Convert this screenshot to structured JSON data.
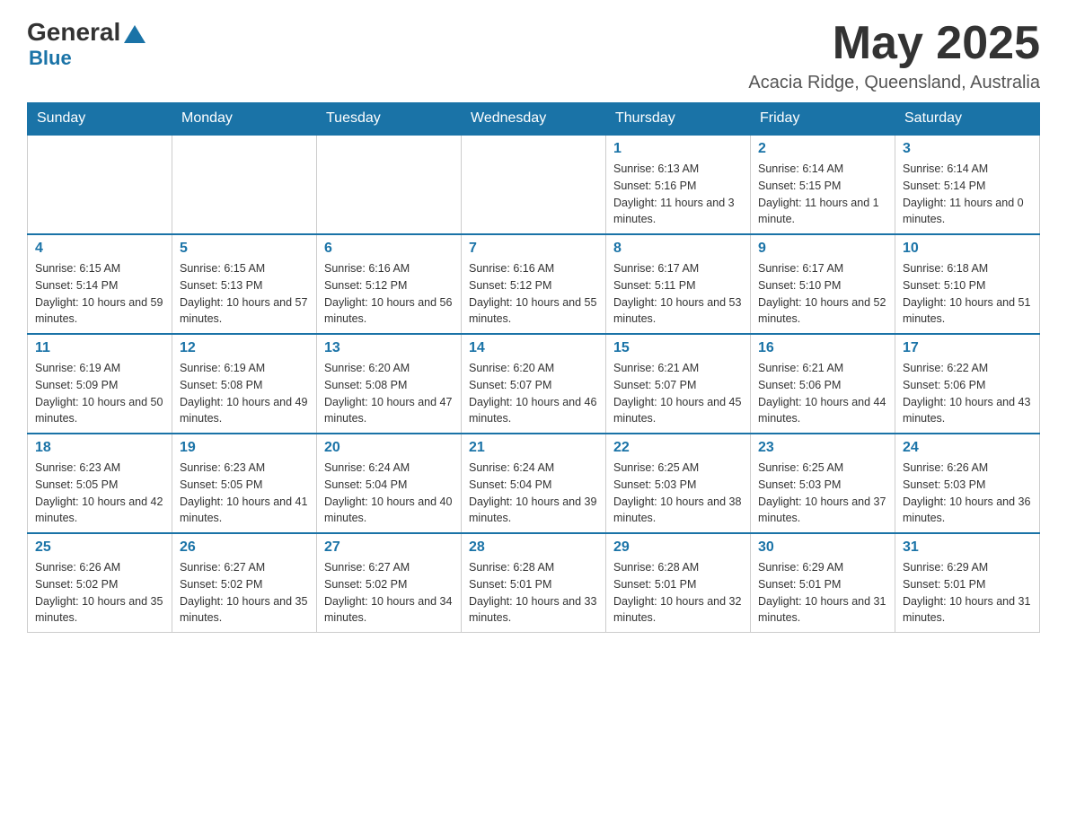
{
  "header": {
    "logo": {
      "general": "General",
      "blue": "Blue"
    },
    "month_title": "May 2025",
    "location": "Acacia Ridge, Queensland, Australia"
  },
  "calendar": {
    "days_of_week": [
      "Sunday",
      "Monday",
      "Tuesday",
      "Wednesday",
      "Thursday",
      "Friday",
      "Saturday"
    ],
    "weeks": [
      [
        {
          "day": "",
          "info": ""
        },
        {
          "day": "",
          "info": ""
        },
        {
          "day": "",
          "info": ""
        },
        {
          "day": "",
          "info": ""
        },
        {
          "day": "1",
          "info": "Sunrise: 6:13 AM\nSunset: 5:16 PM\nDaylight: 11 hours and 3 minutes."
        },
        {
          "day": "2",
          "info": "Sunrise: 6:14 AM\nSunset: 5:15 PM\nDaylight: 11 hours and 1 minute."
        },
        {
          "day": "3",
          "info": "Sunrise: 6:14 AM\nSunset: 5:14 PM\nDaylight: 11 hours and 0 minutes."
        }
      ],
      [
        {
          "day": "4",
          "info": "Sunrise: 6:15 AM\nSunset: 5:14 PM\nDaylight: 10 hours and 59 minutes."
        },
        {
          "day": "5",
          "info": "Sunrise: 6:15 AM\nSunset: 5:13 PM\nDaylight: 10 hours and 57 minutes."
        },
        {
          "day": "6",
          "info": "Sunrise: 6:16 AM\nSunset: 5:12 PM\nDaylight: 10 hours and 56 minutes."
        },
        {
          "day": "7",
          "info": "Sunrise: 6:16 AM\nSunset: 5:12 PM\nDaylight: 10 hours and 55 minutes."
        },
        {
          "day": "8",
          "info": "Sunrise: 6:17 AM\nSunset: 5:11 PM\nDaylight: 10 hours and 53 minutes."
        },
        {
          "day": "9",
          "info": "Sunrise: 6:17 AM\nSunset: 5:10 PM\nDaylight: 10 hours and 52 minutes."
        },
        {
          "day": "10",
          "info": "Sunrise: 6:18 AM\nSunset: 5:10 PM\nDaylight: 10 hours and 51 minutes."
        }
      ],
      [
        {
          "day": "11",
          "info": "Sunrise: 6:19 AM\nSunset: 5:09 PM\nDaylight: 10 hours and 50 minutes."
        },
        {
          "day": "12",
          "info": "Sunrise: 6:19 AM\nSunset: 5:08 PM\nDaylight: 10 hours and 49 minutes."
        },
        {
          "day": "13",
          "info": "Sunrise: 6:20 AM\nSunset: 5:08 PM\nDaylight: 10 hours and 47 minutes."
        },
        {
          "day": "14",
          "info": "Sunrise: 6:20 AM\nSunset: 5:07 PM\nDaylight: 10 hours and 46 minutes."
        },
        {
          "day": "15",
          "info": "Sunrise: 6:21 AM\nSunset: 5:07 PM\nDaylight: 10 hours and 45 minutes."
        },
        {
          "day": "16",
          "info": "Sunrise: 6:21 AM\nSunset: 5:06 PM\nDaylight: 10 hours and 44 minutes."
        },
        {
          "day": "17",
          "info": "Sunrise: 6:22 AM\nSunset: 5:06 PM\nDaylight: 10 hours and 43 minutes."
        }
      ],
      [
        {
          "day": "18",
          "info": "Sunrise: 6:23 AM\nSunset: 5:05 PM\nDaylight: 10 hours and 42 minutes."
        },
        {
          "day": "19",
          "info": "Sunrise: 6:23 AM\nSunset: 5:05 PM\nDaylight: 10 hours and 41 minutes."
        },
        {
          "day": "20",
          "info": "Sunrise: 6:24 AM\nSunset: 5:04 PM\nDaylight: 10 hours and 40 minutes."
        },
        {
          "day": "21",
          "info": "Sunrise: 6:24 AM\nSunset: 5:04 PM\nDaylight: 10 hours and 39 minutes."
        },
        {
          "day": "22",
          "info": "Sunrise: 6:25 AM\nSunset: 5:03 PM\nDaylight: 10 hours and 38 minutes."
        },
        {
          "day": "23",
          "info": "Sunrise: 6:25 AM\nSunset: 5:03 PM\nDaylight: 10 hours and 37 minutes."
        },
        {
          "day": "24",
          "info": "Sunrise: 6:26 AM\nSunset: 5:03 PM\nDaylight: 10 hours and 36 minutes."
        }
      ],
      [
        {
          "day": "25",
          "info": "Sunrise: 6:26 AM\nSunset: 5:02 PM\nDaylight: 10 hours and 35 minutes."
        },
        {
          "day": "26",
          "info": "Sunrise: 6:27 AM\nSunset: 5:02 PM\nDaylight: 10 hours and 35 minutes."
        },
        {
          "day": "27",
          "info": "Sunrise: 6:27 AM\nSunset: 5:02 PM\nDaylight: 10 hours and 34 minutes."
        },
        {
          "day": "28",
          "info": "Sunrise: 6:28 AM\nSunset: 5:01 PM\nDaylight: 10 hours and 33 minutes."
        },
        {
          "day": "29",
          "info": "Sunrise: 6:28 AM\nSunset: 5:01 PM\nDaylight: 10 hours and 32 minutes."
        },
        {
          "day": "30",
          "info": "Sunrise: 6:29 AM\nSunset: 5:01 PM\nDaylight: 10 hours and 31 minutes."
        },
        {
          "day": "31",
          "info": "Sunrise: 6:29 AM\nSunset: 5:01 PM\nDaylight: 10 hours and 31 minutes."
        }
      ]
    ]
  }
}
